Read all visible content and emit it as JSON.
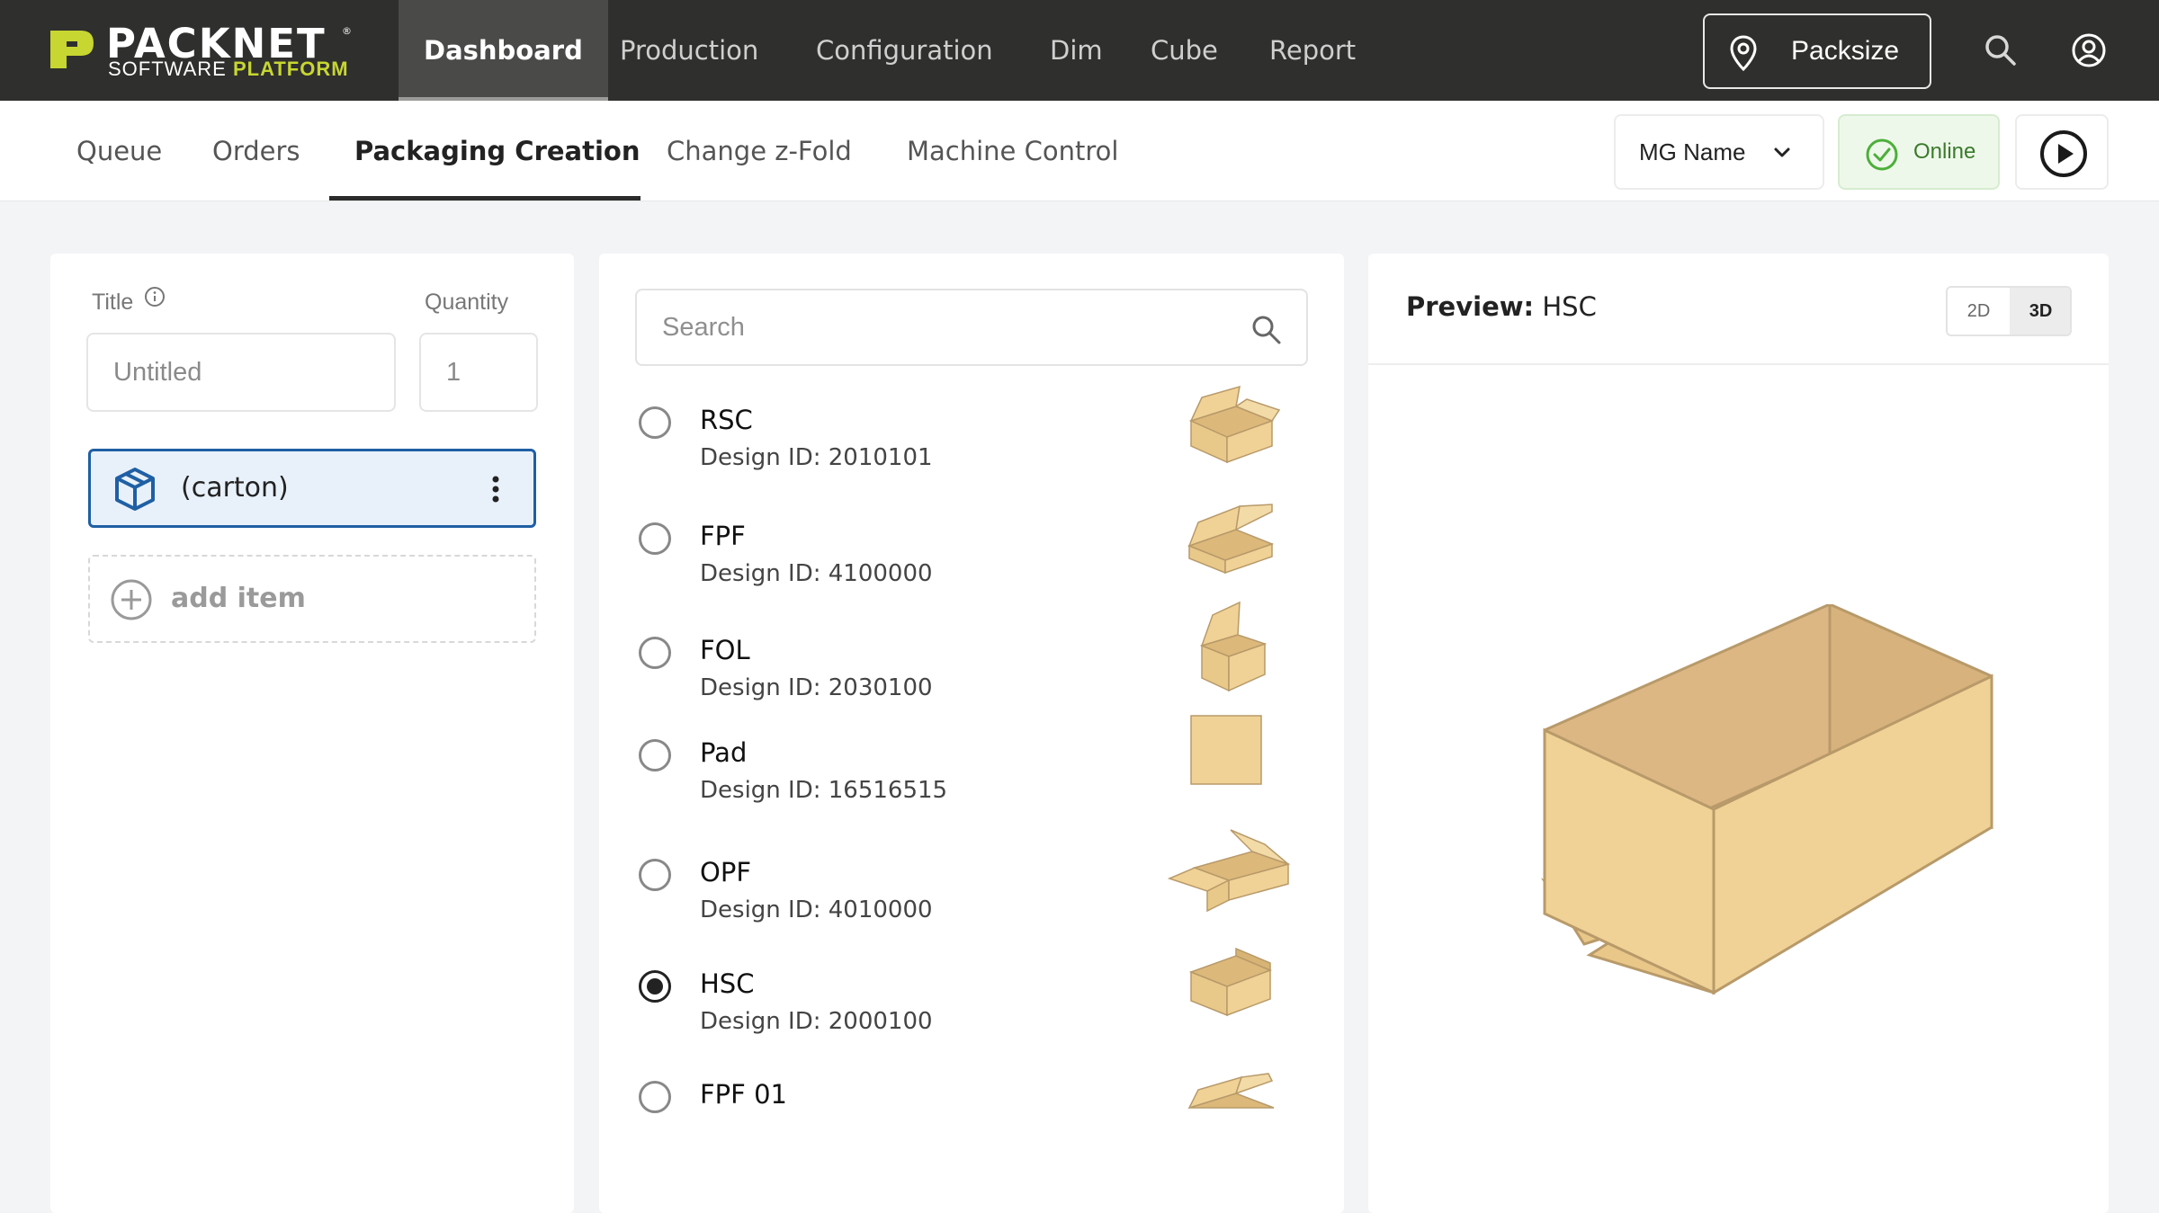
{
  "brand": {
    "name": "PACKNET",
    "trademark": "®",
    "tagline_a": "SOFTWARE",
    "tagline_b": "PLATFORM",
    "accent": "#c7d631"
  },
  "topnav": {
    "items": [
      {
        "label": "Dashboard",
        "active": true
      },
      {
        "label": "Production"
      },
      {
        "label": "Configuration"
      },
      {
        "label": "Dim"
      },
      {
        "label": "Cube"
      },
      {
        "label": "Report"
      }
    ],
    "location_button": "Packsize",
    "icons": [
      "search-icon",
      "user-account-icon",
      "location-pin-icon"
    ]
  },
  "subnav": {
    "items": [
      {
        "label": "Queue"
      },
      {
        "label": "Orders"
      },
      {
        "label": "Packaging Creation",
        "active": true
      },
      {
        "label": "Change z-Fold"
      },
      {
        "label": "Machine Control"
      }
    ],
    "machine_group_select": "MG Name",
    "status": "Online",
    "status_color": "#4caf3a"
  },
  "left_panel": {
    "title_label": "Title",
    "title_placeholder": "Untitled",
    "quantity_label": "Quantity",
    "quantity_value": "1",
    "items": [
      {
        "label": "(carton)",
        "selected": true
      }
    ],
    "add_item_label": "add item",
    "selected_color": "#1f5fa4"
  },
  "middle_panel": {
    "search_placeholder": "Search",
    "designs": [
      {
        "name": "RSC",
        "design_id": "Design ID: 2010101",
        "selected": false,
        "thumb": "rsc-box"
      },
      {
        "name": "FPF",
        "design_id": "Design ID: 4100000",
        "selected": false,
        "thumb": "fpf-box"
      },
      {
        "name": "FOL",
        "design_id": "Design ID: 2030100",
        "selected": false,
        "thumb": "fol-box"
      },
      {
        "name": "Pad",
        "design_id": "Design ID: 16516515",
        "selected": false,
        "thumb": "pad"
      },
      {
        "name": "OPF",
        "design_id": "Design ID: 4010000",
        "selected": false,
        "thumb": "opf-box"
      },
      {
        "name": "HSC",
        "design_id": "Design ID: 2000100",
        "selected": true,
        "thumb": "hsc-box"
      },
      {
        "name": "FPF 01",
        "design_id": "",
        "selected": false,
        "thumb": "fpf01-box"
      }
    ]
  },
  "right_panel": {
    "preview_label": "Preview:",
    "preview_name": "HSC",
    "view_2d": "2D",
    "view_3d": "3D",
    "active_view": "3D",
    "carton_color": "#f0d296",
    "carton_edge": "#b89a6a"
  }
}
